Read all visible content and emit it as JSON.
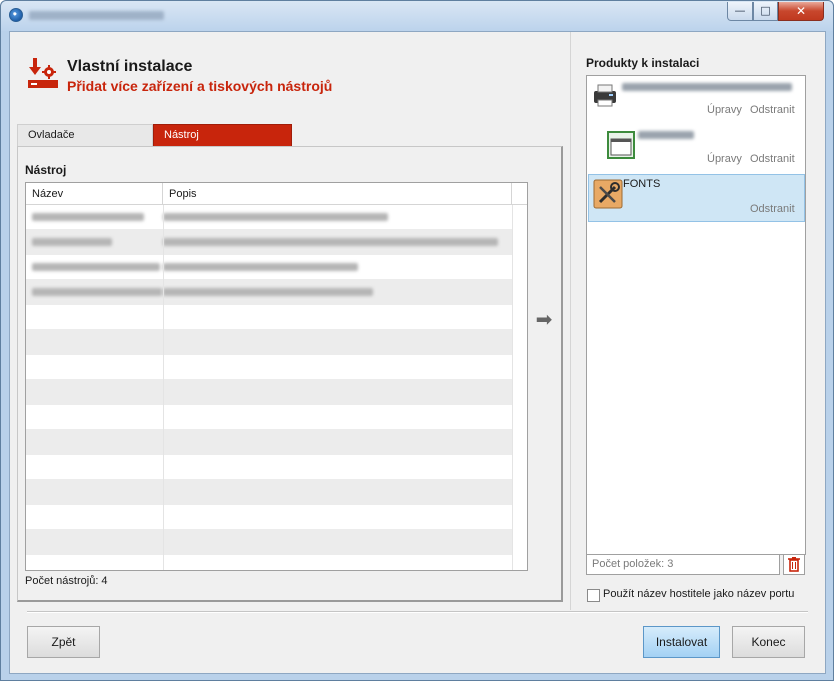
{
  "window": {
    "title": "",
    "controls": {
      "minimize": "—",
      "maximize": "□",
      "close": "✕"
    }
  },
  "header": {
    "title": "Vlastní instalace",
    "subtitle": "Přidat více zařízení a tiskových nástrojů",
    "icon": "download-gear-icon"
  },
  "tabs": [
    {
      "label": "Ovladače",
      "active": false
    },
    {
      "label": "Nástroj",
      "active": true
    }
  ],
  "tools_panel": {
    "heading": "Nástroj",
    "columns": [
      "Název",
      "Popis"
    ],
    "rows_count_visible": 4,
    "count_label": "Počet nástrojů: 4"
  },
  "add_arrow": {
    "icon": "arrow-right-icon",
    "glyph": "➡"
  },
  "products": {
    "heading": "Produkty k instalaci",
    "items": [
      {
        "icon": "printer-icon",
        "name": "",
        "actions": [
          "Úpravy",
          "Odstranit"
        ],
        "selected": false
      },
      {
        "icon": "window-app-icon",
        "name": "",
        "actions": [
          "Úpravy",
          "Odstranit"
        ],
        "selected": false
      },
      {
        "icon": "tools-icon",
        "name": "FONTS",
        "actions": [
          "Odstranit"
        ],
        "selected": true
      }
    ],
    "count_label": "Počet položek: 3",
    "delete_icon": "trash-icon"
  },
  "options": {
    "hostname_as_port": {
      "label": "Použít název hostitele jako název portu",
      "checked": false
    }
  },
  "buttons": {
    "back": "Zpět",
    "install": "Instalovat",
    "end": "Konec"
  },
  "colors": {
    "accent": "#c8250c",
    "selection": "#cfe6f5"
  }
}
